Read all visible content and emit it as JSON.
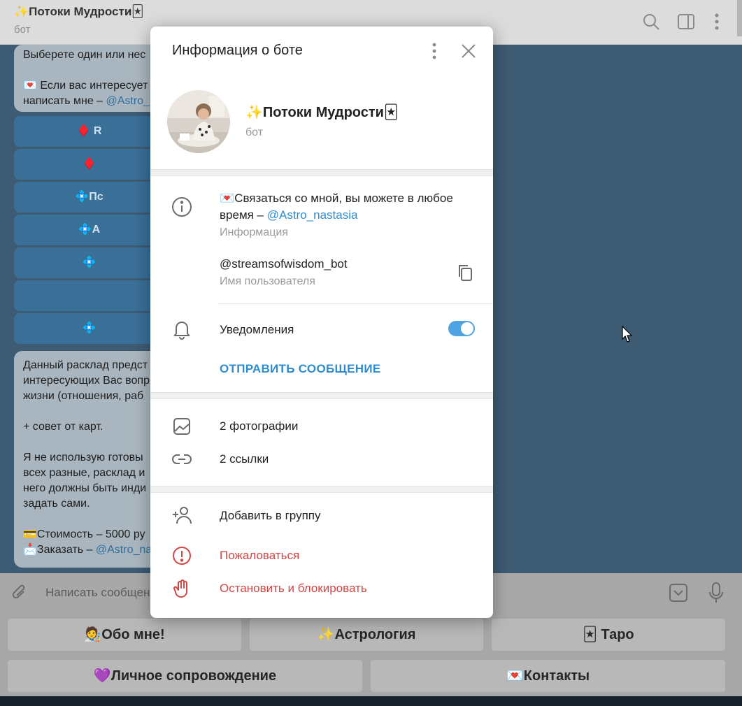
{
  "header": {
    "title": "✨Потоки Мудрости🃏",
    "subtitle": "бот"
  },
  "chat": {
    "message1_lines": [
      "Выберете один или нес",
      "",
      "💌 Если вас интересует",
      "написать мне – "
    ],
    "message1_mention": "@Astro_",
    "buttons": [
      "♦️ R",
      "♦️",
      "💠Пс",
      "💠А",
      "💠",
      "",
      "💠"
    ],
    "message2_lines": [
      "Данный расклад предст",
      "интересующих Вас вопр",
      "жизни (отношения, раб",
      "",
      "+ совет от карт.",
      "",
      "Я не использую готовы",
      "всех разные, расклад и",
      "него должны быть инди",
      "задать сами.",
      "",
      "💳Стоимость – 5000 ру",
      "📩Заказать – "
    ],
    "message2_mention": "@Astro_na"
  },
  "compose": {
    "placeholder": "Написать сообщен"
  },
  "keyboard": {
    "row1": [
      "🧑‍🎨Обо мне!",
      "✨Астрология",
      "🃏 Таро"
    ],
    "row2": [
      "💜Личное сопровождение",
      "💌Контакты"
    ]
  },
  "dialog": {
    "title": "Информация о боте",
    "bot_name": "✨Потоки Мудрости🃏",
    "bot_type": "бот",
    "info_text": "💌Связаться со мной, вы можете в любое время – ",
    "info_mention": "@Astro_nastasia",
    "info_label": "Информация",
    "username": "@streamsofwisdom_bot",
    "username_label": "Имя пользователя",
    "notifications_label": "Уведомления",
    "notifications_on": true,
    "send_message": "ОТПРАВИТЬ СООБЩЕНИЕ",
    "media": {
      "photos": "2 фотографии",
      "links": "2 ссылки"
    },
    "actions": {
      "add_to_group": "Добавить в группу",
      "report": "Пожаловаться",
      "block": "Остановить и блокировать"
    }
  },
  "colors": {
    "accent": "#2e8ccf",
    "danger": "#d14747",
    "toggle": "#4ea3e2"
  }
}
